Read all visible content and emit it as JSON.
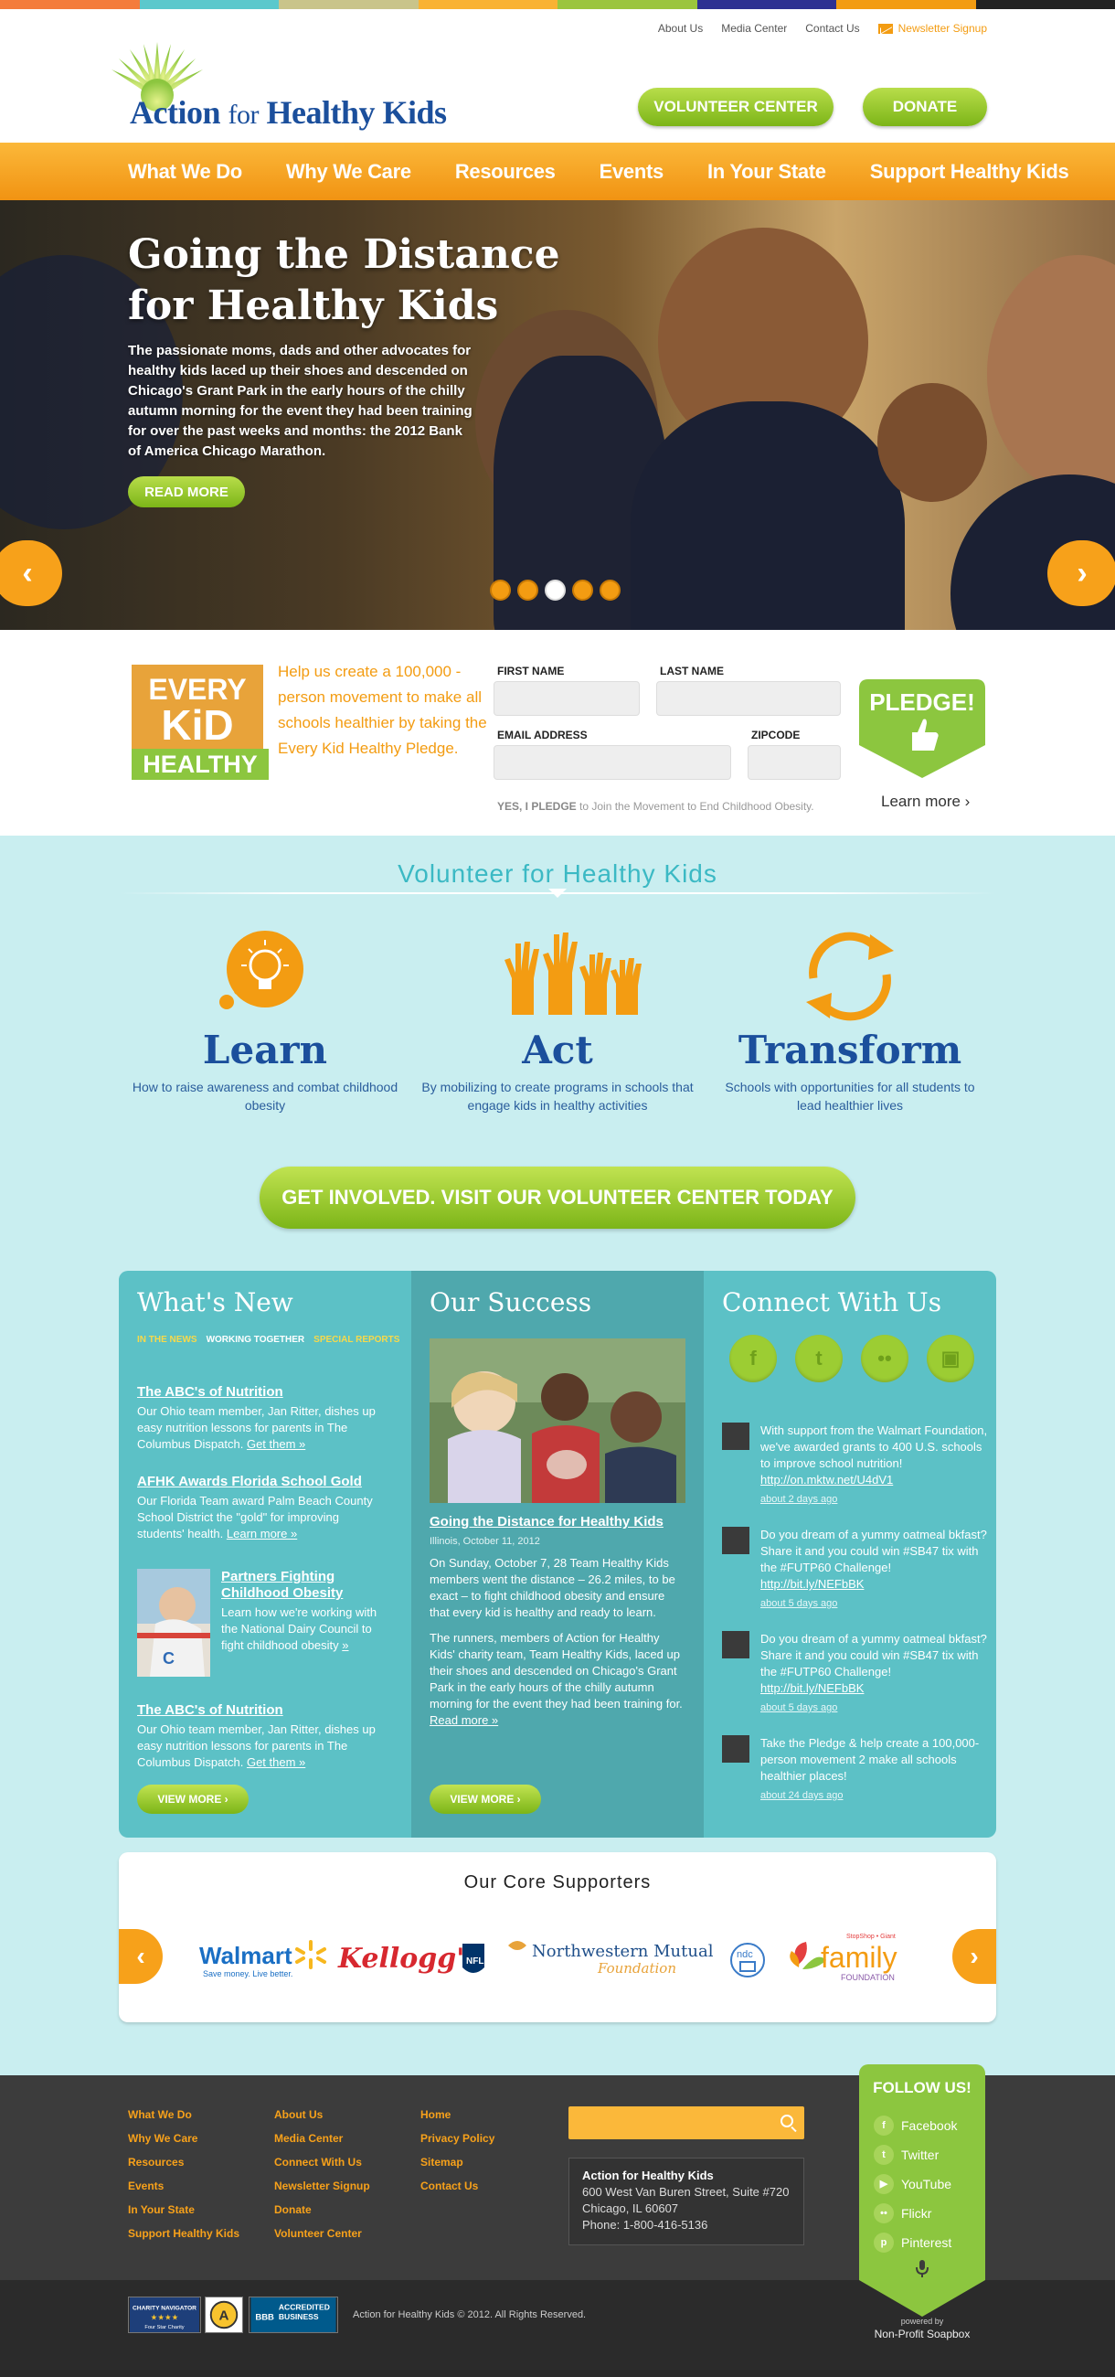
{
  "utility": {
    "about": "About Us",
    "media": "Media Center",
    "contact": "Contact Us",
    "newsletter": "Newsletter Signup"
  },
  "logo": {
    "action": "Action",
    "for": "for",
    "healthy_kids": "Healthy Kids"
  },
  "header_buttons": {
    "volunteer": "VOLUNTEER CENTER",
    "donate": "DONATE"
  },
  "nav": [
    "What We Do",
    "Why We Care",
    "Resources",
    "Events",
    "In Your State",
    "Support Healthy Kids"
  ],
  "hero": {
    "title": "Going the Distance for Healthy Kids",
    "body": "The passionate moms, dads and other advocates for healthy kids laced up their shoes and descended on Chicago's Grant Park in the early hours of the chilly autumn morning for the event they had been training for over the past weeks and months: the 2012 Bank of America Chicago Marathon.",
    "read_more": "READ MORE",
    "prev": "‹",
    "next": "›",
    "active_slide": 3,
    "slide_count": 5
  },
  "pledge": {
    "badge_every": "EVERY",
    "badge_kid": "KiD",
    "badge_healthy": "HEALTHY",
    "text": "Help us create a 100,000 - person movement to make all schools healthier by taking the Every Kid Healthy Pledge.",
    "first_name": "FIRST NAME",
    "last_name": "LAST NAME",
    "email": "EMAIL ADDRESS",
    "zipcode": "ZIPCODE",
    "note_bold": "YES, I PLEDGE",
    "note_rest": " to Join the Movement to End Childhood Obesity.",
    "button": "PLEDGE!",
    "learn_more": "Learn more ›"
  },
  "volunteer": {
    "title": "Volunteer for Healthy Kids",
    "columns": [
      {
        "word": "Learn",
        "desc": "How to raise awareness and combat childhood obesity",
        "icon": "lightbulb-icon"
      },
      {
        "word": "Act",
        "desc": "By mobilizing to create programs in schools that engage kids in healthy activities",
        "icon": "raised-hands-icon"
      },
      {
        "word": "Transform",
        "desc": "Schools with opportunities for all students to lead healthier lives",
        "icon": "cycle-arrows-icon"
      }
    ],
    "cta": "GET INVOLVED. VISIT OUR VOLUNTEER CENTER TODAY"
  },
  "whats_new": {
    "title": "What's New",
    "tabs": [
      "IN THE NEWS",
      "WORKING TOGETHER",
      "SPECIAL REPORTS"
    ],
    "items": [
      {
        "title": "The ABC's of Nutrition",
        "body": "Our Ohio team member, Jan Ritter, dishes up easy nutrition lessons for parents in The Columbus Dispatch. ",
        "link": "Get them »"
      },
      {
        "title": "AFHK Awards Florida School Gold",
        "body": "Our Florida Team award Palm Beach County School District the \"gold\" for improving students' health. ",
        "link": "Learn more »"
      },
      {
        "title": "Partners Fighting Childhood Obesity",
        "body": "Learn how we're working with the National Dairy Council to fight childhood obesity ",
        "link": "»"
      },
      {
        "title": "The ABC's of Nutrition",
        "body": "Our Ohio team member, Jan Ritter, dishes up easy nutrition lessons for parents in The Columbus Dispatch. ",
        "link": "Get them »"
      }
    ],
    "view_more": "VIEW MORE ›"
  },
  "our_success": {
    "title": "Our Success",
    "story_title": "Going the Distance for Healthy Kids",
    "dateline": "Illinois, October 11, 2012",
    "p1": "On Sunday, October 7, 28 Team Healthy Kids members went the distance – 26.2 miles, to be exact – to fight childhood obesity and ensure that every kid is healthy and ready to learn.",
    "p2": "The runners, members of Action for Healthy Kids' charity team, Team Healthy Kids, laced up their shoes and descended on Chicago's Grant Park in the early hours of the chilly autumn morning for the event they had been training for. ",
    "read_more": "Read more »",
    "view_more": "VIEW MORE ›"
  },
  "connect": {
    "title": "Connect With Us",
    "icons": [
      "facebook-icon",
      "twitter-icon",
      "flickr-icon",
      "youtube-icon"
    ],
    "icon_glyphs": [
      "f",
      "t",
      "••",
      "▣"
    ],
    "tweets": [
      {
        "text": "With support from the Walmart Foundation, we've awarded grants to 400 U.S. schools to improve school nutrition! ",
        "link": "http://on.mktw.net/U4dV1",
        "ago": "about 2 days ago"
      },
      {
        "text": "Do you dream of a yummy oatmeal bkfast? Share it and you could win #SB47 tix with the #FUTP60 Challenge! ",
        "link": "http://bit.ly/NEFbBK",
        "ago": "about 5 days ago"
      },
      {
        "text": "Do you dream of a yummy oatmeal bkfast? Share it and you could win #SB47 tix with the #FUTP60 Challenge! ",
        "link": "http://bit.ly/NEFbBK",
        "ago": "about 5 days ago"
      },
      {
        "text": "Take the Pledge & help create a 100,000-person movement 2 make all schools healthier places!",
        "link": "",
        "ago": "about 24 days ago"
      }
    ]
  },
  "supporters": {
    "title": "Our Core Supporters",
    "walmart": "Walmart",
    "walmart_tag": "Save money. Live better.",
    "kelloggs": "Kellogg's",
    "nfl": "NFL",
    "nm": "Northwestern Mutual",
    "nm_sub": "Foundation",
    "ndc": "ndc",
    "family": "family",
    "family_sub": "FOUNDATION",
    "family_top": "StopShop • Giant"
  },
  "footer": {
    "col1": [
      "What We Do",
      "Why We Care",
      "Resources",
      "Events",
      "In Your State",
      "Support Healthy Kids"
    ],
    "col2": [
      "About Us",
      "Media Center",
      "Connect With Us",
      "Newsletter Signup",
      "Donate",
      "Volunteer Center"
    ],
    "col3": [
      "Home",
      "Privacy Policy",
      "Sitemap",
      "Contact Us"
    ],
    "org": "Action for Healthy Kids",
    "addr1": "600 West Van Buren Street, Suite #720",
    "addr2": "Chicago, IL 60607",
    "phone": "Phone: 1-800-416-5136",
    "follow_title": "FOLLOW US!",
    "follow": [
      "Facebook",
      "Twitter",
      "YouTube",
      "Flickr",
      "Pinterest"
    ],
    "copyright": "Action for Healthy Kids © 2012. All Rights Reserved.",
    "powered_by": "powered by",
    "soapbox": "Non-Profit Soapbox",
    "badge1": "CHARITY NAVIGATOR",
    "badge1_sub": "Four Star Charity",
    "badge2": "A",
    "badge3": "BBB",
    "badge3_sub": "ACCREDITED BUSINESS"
  },
  "colors": {
    "orange": "#f39c12",
    "green": "#8cc63f",
    "blue": "#1b4f9c",
    "teal": "#3bb9c4"
  }
}
